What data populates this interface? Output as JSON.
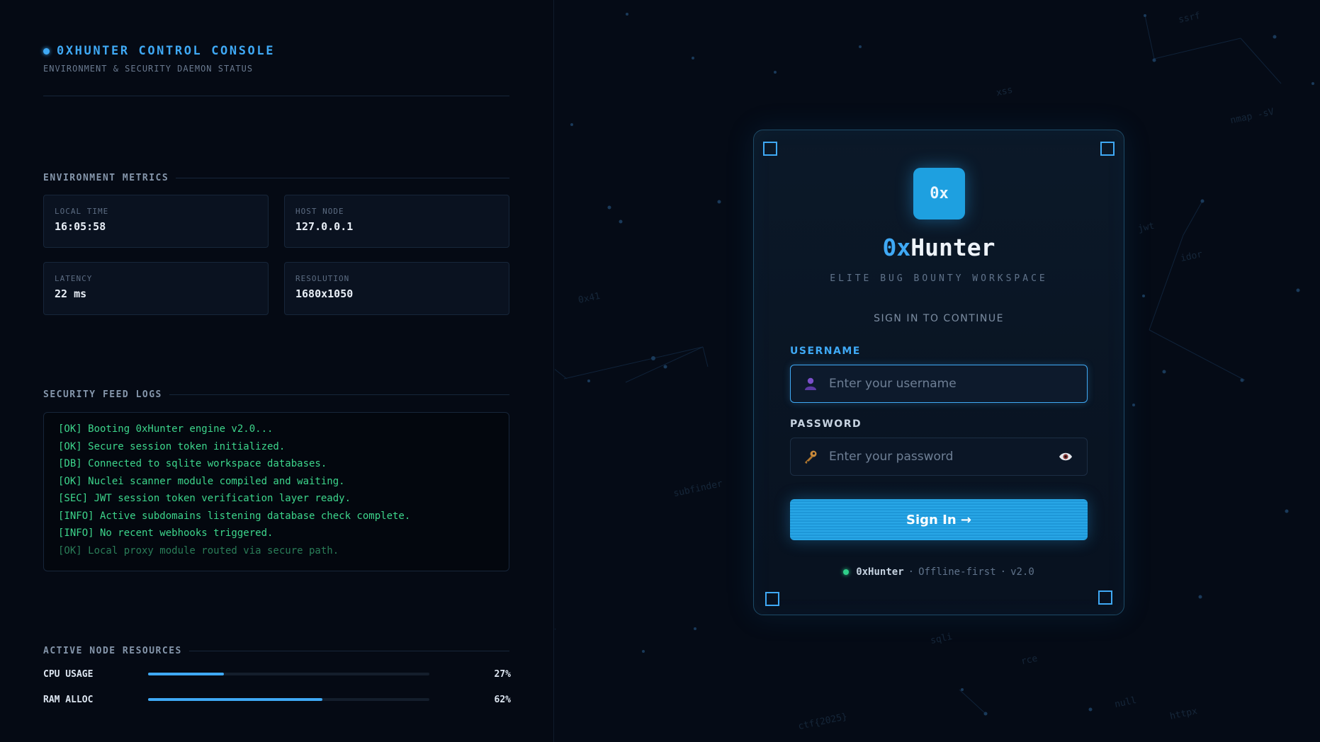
{
  "console": {
    "title": "0XHUNTER CONTROL CONSOLE",
    "subtitle": "ENVIRONMENT & SECURITY DAEMON STATUS"
  },
  "metrics": {
    "section_label": "ENVIRONMENT METRICS",
    "items": [
      {
        "label": "LOCAL TIME",
        "value": "16:05:58"
      },
      {
        "label": "HOST NODE",
        "value": "127.0.0.1"
      },
      {
        "label": "LATENCY",
        "value": "22 ms"
      },
      {
        "label": "RESOLUTION",
        "value": "1680x1050"
      }
    ]
  },
  "logs": {
    "section_label": "SECURITY FEED LOGS",
    "lines": [
      "[OK] Booting 0xHunter engine v2.0...",
      "[OK] Secure session token initialized.",
      "[DB] Connected to sqlite workspace databases.",
      "[OK] Nuclei scanner module compiled and waiting.",
      "[SEC] JWT session token verification layer ready.",
      "[INFO] Active subdomains listening database check complete.",
      "[INFO] No recent webhooks triggered.",
      "[OK] Local proxy module routed via secure path."
    ]
  },
  "resources": {
    "section_label": "ACTIVE NODE RESOURCES",
    "items": [
      {
        "label": "CPU USAGE",
        "value_text": "27%",
        "fraction": 0.27
      },
      {
        "label": "RAM ALLOC",
        "value_text": "62%",
        "fraction": 0.62
      }
    ]
  },
  "background_words": [
    "ssrf",
    "xss",
    "nmap -sV",
    "0x41",
    "jwt",
    "idor",
    "subfinder",
    "sqli",
    "rce",
    "null",
    "httpx",
    "ctf{2025}",
    "jwt"
  ],
  "login": {
    "logo_text": "0x",
    "brand_prefix": "0x",
    "brand_suffix": "Hunter",
    "tagline": "ELITE BUG BOUNTY WORKSPACE",
    "signin_note": "SIGN IN TO CONTINUE",
    "username_label": "USERNAME",
    "username_placeholder": "Enter your username",
    "password_label": "PASSWORD",
    "password_placeholder": "Enter your password",
    "submit_label": "Sign In →",
    "footer_brand": "0xHunter",
    "footer_sep1": "·",
    "footer_mode": "Offline-first",
    "footer_sep2": "·",
    "footer_version": "v2.0"
  },
  "colors": {
    "accent": "#3fa9f5",
    "log_green": "#3dd68c",
    "status_green": "#2fd08a",
    "background": "#050b16"
  },
  "icons": {
    "username_field": "user-icon",
    "password_field": "key-icon",
    "password_toggle": "eye-icon",
    "status": "status-dot-icon"
  }
}
